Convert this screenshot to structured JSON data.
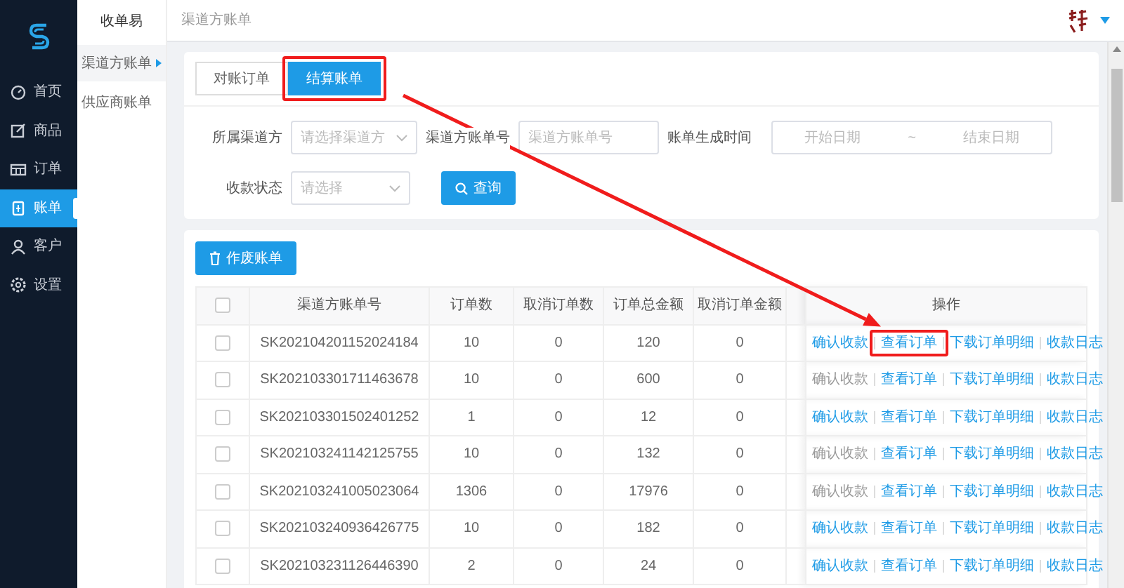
{
  "sidebar": {
    "items": [
      {
        "label": "首页",
        "selected": false
      },
      {
        "label": "商品",
        "selected": false
      },
      {
        "label": "订单",
        "selected": false
      },
      {
        "label": "账单",
        "selected": true
      },
      {
        "label": "客户",
        "selected": false
      },
      {
        "label": "设置",
        "selected": false
      }
    ]
  },
  "subnav": {
    "title": "收单易",
    "items": [
      {
        "label": "渠道方账单",
        "selected": true
      },
      {
        "label": "供应商账单",
        "selected": false
      }
    ]
  },
  "topbar": {
    "breadcrumb": "渠道方账单"
  },
  "tabs": [
    {
      "label": "对账订单",
      "selected": false,
      "highlighted": false
    },
    {
      "label": "结算账单",
      "selected": true,
      "highlighted": true
    }
  ],
  "filters": [
    {
      "label": "所属渠道方",
      "kind": "select",
      "placeholder": "请选择渠道方"
    },
    {
      "label": "渠道方账单号",
      "kind": "input",
      "placeholder": "渠道方账单号"
    },
    {
      "label": "账单生成时间",
      "kind": "daterange",
      "start_placeholder": "开始日期",
      "separator": "~",
      "end_placeholder": "结束日期"
    },
    {
      "label": "收款状态",
      "kind": "select",
      "placeholder": "请选择"
    }
  ],
  "query_button": "查询",
  "void_button": "作废账单",
  "table": {
    "header_checked": false,
    "columns": [
      "渠道方账单号",
      "订单数",
      "取消订单数",
      "订单总金额",
      "取消订单金额",
      "操作"
    ],
    "rows": [
      {
        "checked": false,
        "cells": [
          "SK202104201152024184",
          "10",
          "0",
          "120",
          "0"
        ],
        "actions": [
          {
            "label": "确认收款",
            "disabled": false,
            "highlighted": false
          },
          {
            "label": "查看订单",
            "disabled": false,
            "highlighted": true
          },
          {
            "label": "下载订单明细",
            "disabled": false,
            "highlighted": false
          },
          {
            "label": "收款日志",
            "disabled": false,
            "highlighted": false
          }
        ]
      },
      {
        "checked": false,
        "cells": [
          "SK202103301711463678",
          "10",
          "0",
          "600",
          "0"
        ],
        "actions": [
          {
            "label": "确认收款",
            "disabled": true,
            "highlighted": false
          },
          {
            "label": "查看订单",
            "disabled": false,
            "highlighted": false
          },
          {
            "label": "下载订单明细",
            "disabled": false,
            "highlighted": false
          },
          {
            "label": "收款日志",
            "disabled": false,
            "highlighted": false
          }
        ]
      },
      {
        "checked": false,
        "cells": [
          "SK202103301502401252",
          "1",
          "0",
          "12",
          "0"
        ],
        "actions": [
          {
            "label": "确认收款",
            "disabled": false,
            "highlighted": false
          },
          {
            "label": "查看订单",
            "disabled": false,
            "highlighted": false
          },
          {
            "label": "下载订单明细",
            "disabled": false,
            "highlighted": false
          },
          {
            "label": "收款日志",
            "disabled": false,
            "highlighted": false
          }
        ]
      },
      {
        "checked": false,
        "cells": [
          "SK202103241142125755",
          "10",
          "0",
          "132",
          "0"
        ],
        "actions": [
          {
            "label": "确认收款",
            "disabled": true,
            "highlighted": false
          },
          {
            "label": "查看订单",
            "disabled": false,
            "highlighted": false
          },
          {
            "label": "下载订单明细",
            "disabled": false,
            "highlighted": false
          },
          {
            "label": "收款日志",
            "disabled": false,
            "highlighted": false
          }
        ]
      },
      {
        "checked": false,
        "cells": [
          "SK202103241005023064",
          "1306",
          "0",
          "17976",
          "0"
        ],
        "actions": [
          {
            "label": "确认收款",
            "disabled": true,
            "highlighted": false
          },
          {
            "label": "查看订单",
            "disabled": false,
            "highlighted": false
          },
          {
            "label": "下载订单明细",
            "disabled": false,
            "highlighted": false
          },
          {
            "label": "收款日志",
            "disabled": false,
            "highlighted": false
          }
        ]
      },
      {
        "checked": false,
        "cells": [
          "SK202103240936426775",
          "10",
          "0",
          "182",
          "0"
        ],
        "actions": [
          {
            "label": "确认收款",
            "disabled": false,
            "highlighted": false
          },
          {
            "label": "查看订单",
            "disabled": false,
            "highlighted": false
          },
          {
            "label": "下载订单明细",
            "disabled": false,
            "highlighted": false
          },
          {
            "label": "收款日志",
            "disabled": false,
            "highlighted": false
          }
        ]
      },
      {
        "checked": false,
        "cells": [
          "SK202103231126446390",
          "2",
          "0",
          "24",
          "0"
        ],
        "actions": [
          {
            "label": "确认收款",
            "disabled": false,
            "highlighted": false
          },
          {
            "label": "查看订单",
            "disabled": false,
            "highlighted": false
          },
          {
            "label": "下载订单明细",
            "disabled": false,
            "highlighted": false
          },
          {
            "label": "收款日志",
            "disabled": false,
            "highlighted": false
          }
        ]
      }
    ]
  },
  "annotation_arrow": true
}
